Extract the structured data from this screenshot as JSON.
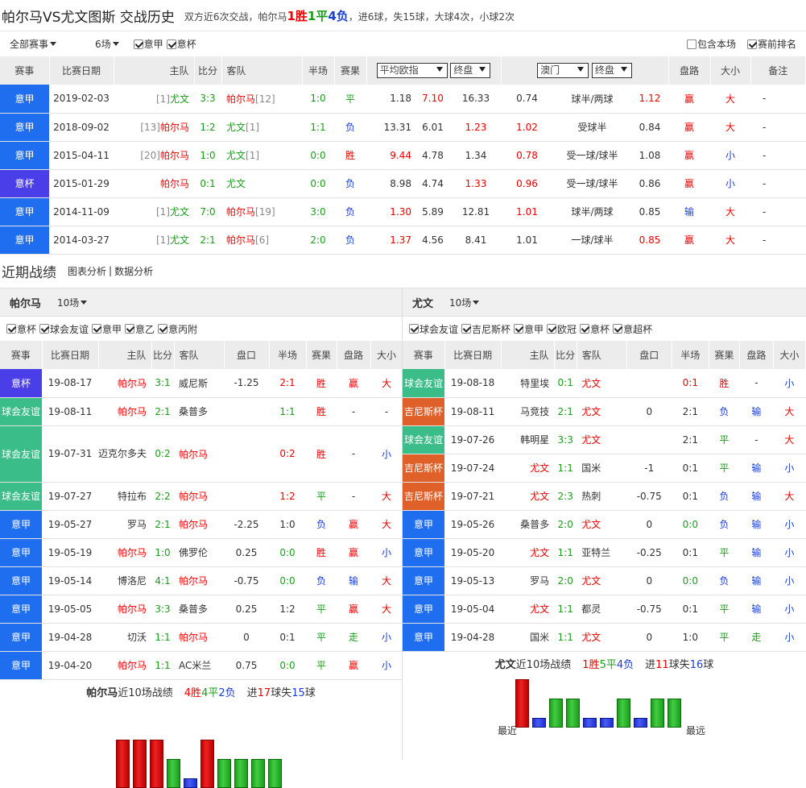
{
  "header": {
    "title": "帕尔马VS尤文图斯 交战历史",
    "summary_pre": "双方近6次交战，帕尔马",
    "win": "1胜",
    "draw": "1平",
    "loss": "4负",
    "summary_post": "，进6球，失15球，大球4次，小球2次"
  },
  "filter": {
    "all": "全部赛事",
    "count": "6场",
    "cb1": "意甲",
    "cb2": "意杯",
    "include": "包含本场",
    "rank": "赛前排名"
  },
  "h2h_cols": [
    "赛事",
    "比赛日期",
    "主队",
    "比分",
    "客队",
    "半场",
    "赛果",
    "平均欧指",
    "终盘",
    "澳门",
    "终盘",
    "盘路",
    "大小",
    "备注"
  ],
  "h2h_rows": [
    {
      "lg": "意甲",
      "lc": "#1f6ef0",
      "date": "2019-02-03",
      "hr": "[1]",
      "home": "尤文",
      "hc": "g",
      "score": "3:3",
      "away": "帕尔马",
      "ac": "r",
      "ar": "[12]",
      "ht": "1:0",
      "res": "平",
      "rc": "g",
      "o1": "1.18",
      "o2": "7.10",
      "o3": "16.33",
      "o2c": "r",
      "o3c": "",
      "a1": "0.74",
      "hcp": "球半/两球",
      "a2": "1.12",
      "a1c": "",
      "a2c": "r",
      "pl": "赢",
      "plc": "r",
      "ou": "大",
      "ouc": "r",
      "note": "-"
    },
    {
      "lg": "意甲",
      "lc": "#1f6ef0",
      "date": "2018-09-02",
      "hr": "[13]",
      "home": "帕尔马",
      "hc": "r",
      "score": "1:2",
      "away": "尤文",
      "ac": "g",
      "ar": "[1]",
      "ht": "1:1",
      "res": "负",
      "rc": "b",
      "o1": "13.31",
      "o2": "6.01",
      "o3": "1.23",
      "o2c": "",
      "o3c": "r",
      "a1": "1.02",
      "hcp": "受球半",
      "a2": "0.84",
      "a1c": "r",
      "a2c": "",
      "pl": "赢",
      "plc": "r",
      "ou": "大",
      "ouc": "r",
      "note": "-"
    },
    {
      "lg": "意甲",
      "lc": "#1f6ef0",
      "date": "2015-04-11",
      "hr": "[20]",
      "home": "帕尔马",
      "hc": "r",
      "score": "1:0",
      "away": "尤文",
      "ac": "g",
      "ar": "[1]",
      "ht": "0:0",
      "res": "胜",
      "rc": "r",
      "o1": "9.44",
      "o2": "4.78",
      "o3": "1.34",
      "o2c": "",
      "o3c": "",
      "a1": "0.78",
      "hcp": "受一球/球半",
      "a2": "1.08",
      "a1c": "r",
      "a2c": "",
      "pl": "赢",
      "plc": "r",
      "ou": "小",
      "ouc": "b",
      "note": "-",
      "o1c": "r"
    },
    {
      "lg": "意杯",
      "lc": "#4a3ee8",
      "date": "2015-01-29",
      "hr": "",
      "home": "帕尔马",
      "hc": "r",
      "score": "0:1",
      "away": "尤文",
      "ac": "g",
      "ar": "",
      "ht": "0:0",
      "res": "负",
      "rc": "b",
      "o1": "8.98",
      "o2": "4.74",
      "o3": "1.33",
      "o2c": "",
      "o3c": "r",
      "a1": "0.96",
      "hcp": "受一球/球半",
      "a2": "0.86",
      "a1c": "r",
      "a2c": "",
      "pl": "赢",
      "plc": "r",
      "ou": "小",
      "ouc": "b",
      "note": "-"
    },
    {
      "lg": "意甲",
      "lc": "#1f6ef0",
      "date": "2014-11-09",
      "hr": "[1]",
      "home": "尤文",
      "hc": "g",
      "score": "7:0",
      "away": "帕尔马",
      "ac": "r",
      "ar": "[19]",
      "ht": "3:0",
      "res": "负",
      "rc": "b",
      "o1": "1.30",
      "o2": "5.89",
      "o3": "12.81",
      "o2c": "",
      "o3c": "",
      "a1": "1.01",
      "hcp": "球半/两球",
      "a2": "0.85",
      "a1c": "r",
      "a2c": "",
      "pl": "输",
      "plc": "b",
      "ou": "大",
      "ouc": "r",
      "note": "-",
      "o1c": "r"
    },
    {
      "lg": "意甲",
      "lc": "#1f6ef0",
      "date": "2014-03-27",
      "hr": "[1]",
      "home": "尤文",
      "hc": "g",
      "score": "2:1",
      "away": "帕尔马",
      "ac": "r",
      "ar": "[6]",
      "ht": "2:0",
      "res": "负",
      "rc": "b",
      "o1": "1.37",
      "o2": "4.56",
      "o3": "8.41",
      "o2c": "",
      "o3c": "",
      "a1": "1.01",
      "hcp": "一球/球半",
      "a2": "0.85",
      "a1c": "",
      "a2c": "r",
      "pl": "赢",
      "plc": "r",
      "ou": "大",
      "ouc": "r",
      "note": "-",
      "o1c": "r"
    }
  ],
  "h2h_dd": {
    "avg": "平均欧指",
    "end1": "终盘",
    "macau": "澳门",
    "end2": "终盘"
  },
  "recent": {
    "title": "近期战绩",
    "chart_link": "图表分析",
    "data_link": "数据分析",
    "sep": "|"
  },
  "left": {
    "team": "帕尔马",
    "count": "10场",
    "filters": [
      "意杯",
      "球会友谊",
      "意甲",
      "意乙",
      "意丙附"
    ],
    "cols": [
      "赛事",
      "比赛日期",
      "主队",
      "比分",
      "客队",
      "盘口",
      "半场",
      "赛果",
      "盘路",
      "大小"
    ],
    "rows": [
      {
        "lg": "意杯",
        "lc": "#4a3ee8",
        "date": "19-08-17",
        "home": "帕尔马",
        "hc": "r",
        "score": "3:1",
        "away": "威尼斯",
        "ac": "",
        "hcp": "-1.25",
        "ht": "2:1",
        "htc": "r",
        "res": "胜",
        "rc": "r",
        "pl": "赢",
        "plc": "r",
        "ou": "大",
        "ouc": "r"
      },
      {
        "lg": "球会友谊",
        "lc": "#3bbd8a",
        "date": "19-08-11",
        "home": "帕尔马",
        "hc": "r",
        "score": "2:1",
        "away": "桑普多",
        "ac": "",
        "hcp": "",
        "ht": "1:1",
        "htc": "g",
        "res": "胜",
        "rc": "r",
        "pl": "-",
        "plc": "",
        "ou": "-",
        "ouc": ""
      },
      {
        "lg": "球会友谊",
        "lc": "#3bbd8a",
        "date": "19-07-31",
        "home": "迈克尔多夫",
        "hc": "",
        "score": "0:2",
        "away": "帕尔马",
        "ac": "r",
        "hcp": "",
        "ht": "0:2",
        "htc": "r",
        "res": "胜",
        "rc": "r",
        "pl": "-",
        "plc": "",
        "ou": "小",
        "ouc": "b",
        "tall": true
      },
      {
        "lg": "球会友谊",
        "lc": "#3bbd8a",
        "date": "19-07-27",
        "home": "特拉布",
        "hc": "",
        "score": "2:2",
        "away": "帕尔马",
        "ac": "r",
        "hcp": "",
        "ht": "1:2",
        "htc": "r",
        "res": "平",
        "rc": "g",
        "pl": "-",
        "plc": "",
        "ou": "大",
        "ouc": "r"
      },
      {
        "lg": "意甲",
        "lc": "#1f6ef0",
        "date": "19-05-27",
        "home": "罗马",
        "hc": "",
        "score": "2:1",
        "away": "帕尔马",
        "ac": "r",
        "hcp": "-2.25",
        "ht": "1:0",
        "htc": "",
        "res": "负",
        "rc": "b",
        "pl": "赢",
        "plc": "r",
        "ou": "大",
        "ouc": "r"
      },
      {
        "lg": "意甲",
        "lc": "#1f6ef0",
        "date": "19-05-19",
        "home": "帕尔马",
        "hc": "r",
        "score": "1:0",
        "away": "佛罗伦",
        "ac": "",
        "hcp": "0.25",
        "ht": "0:0",
        "htc": "g",
        "res": "胜",
        "rc": "r",
        "pl": "赢",
        "plc": "r",
        "ou": "小",
        "ouc": "b"
      },
      {
        "lg": "意甲",
        "lc": "#1f6ef0",
        "date": "19-05-14",
        "home": "博洛尼",
        "hc": "",
        "score": "4:1",
        "away": "帕尔马",
        "ac": "r",
        "hcp": "-0.75",
        "ht": "0:0",
        "htc": "g",
        "res": "负",
        "rc": "b",
        "pl": "输",
        "plc": "b",
        "ou": "大",
        "ouc": "r"
      },
      {
        "lg": "意甲",
        "lc": "#1f6ef0",
        "date": "19-05-05",
        "home": "帕尔马",
        "hc": "r",
        "score": "3:3",
        "away": "桑普多",
        "ac": "",
        "hcp": "0.25",
        "ht": "1:2",
        "htc": "",
        "res": "平",
        "rc": "g",
        "pl": "赢",
        "plc": "r",
        "ou": "大",
        "ouc": "r"
      },
      {
        "lg": "意甲",
        "lc": "#1f6ef0",
        "date": "19-04-28",
        "home": "切沃",
        "hc": "",
        "score": "1:1",
        "away": "帕尔马",
        "ac": "r",
        "hcp": "0",
        "ht": "0:1",
        "htc": "",
        "res": "平",
        "rc": "g",
        "pl": "走",
        "plc": "g",
        "ou": "小",
        "ouc": "b"
      },
      {
        "lg": "意甲",
        "lc": "#1f6ef0",
        "date": "19-04-20",
        "home": "帕尔马",
        "hc": "r",
        "score": "1:1",
        "away": "AC米兰",
        "ac": "",
        "hcp": "0.75",
        "ht": "0:0",
        "htc": "g",
        "res": "平",
        "rc": "g",
        "pl": "赢",
        "plc": "r",
        "ou": "小",
        "ouc": "b"
      }
    ],
    "summary": {
      "team": "帕尔马",
      "mid": "近10场战绩",
      "w": "4胜",
      "d": "4平",
      "l": "2负",
      "goals_pre": "进",
      "gf": "17",
      "goals_mid": "球失",
      "ga": "15",
      "goals_post": "球"
    },
    "bars": [
      "w",
      "w",
      "w",
      "d",
      "l",
      "w",
      "d",
      "d",
      "d",
      "d"
    ],
    "bar_levels": [
      5,
      5,
      5,
      3,
      1,
      5,
      3,
      3,
      3,
      3
    ]
  },
  "right": {
    "team": "尤文",
    "count": "10场",
    "filters": [
      "球会友谊",
      "吉尼斯杯",
      "意甲",
      "欧冠",
      "意杯",
      "意超杯"
    ],
    "cols": [
      "赛事",
      "比赛日期",
      "主队",
      "比分",
      "客队",
      "盘口",
      "半场",
      "赛果",
      "盘路",
      "大小"
    ],
    "rows": [
      {
        "lg": "球会友谊",
        "lc": "#3bbd8a",
        "date": "19-08-18",
        "home": "特里埃",
        "hc": "",
        "score": "0:1",
        "away": "尤文",
        "ac": "r",
        "hcp": "",
        "ht": "0:1",
        "htc": "r",
        "res": "胜",
        "rc": "r",
        "pl": "-",
        "plc": "",
        "ou": "小",
        "ouc": "b"
      },
      {
        "lg": "吉尼斯杯",
        "lc": "#e0602a",
        "date": "19-08-11",
        "home": "马竞技",
        "hc": "",
        "score": "2:1",
        "away": "尤文",
        "ac": "r",
        "hcp": "0",
        "ht": "2:1",
        "htc": "",
        "res": "负",
        "rc": "b",
        "pl": "输",
        "plc": "b",
        "ou": "大",
        "ouc": "r"
      },
      {
        "lg": "球会友谊",
        "lc": "#3bbd8a",
        "date": "19-07-26",
        "home": "韩明星",
        "hc": "",
        "score": "3:3",
        "away": "尤文",
        "ac": "r",
        "hcp": "",
        "ht": "2:1",
        "htc": "",
        "res": "平",
        "rc": "g",
        "pl": "-",
        "plc": "",
        "ou": "大",
        "ouc": "r"
      },
      {
        "lg": "吉尼斯杯",
        "lc": "#e0602a",
        "date": "19-07-24",
        "home": "尤文",
        "hc": "r",
        "score": "1:1",
        "away": "国米",
        "ac": "",
        "hcp": "-1",
        "ht": "0:1",
        "htc": "",
        "res": "平",
        "rc": "g",
        "pl": "输",
        "plc": "b",
        "ou": "小",
        "ouc": "b"
      },
      {
        "lg": "吉尼斯杯",
        "lc": "#e0602a",
        "date": "19-07-21",
        "home": "尤文",
        "hc": "r",
        "score": "2:3",
        "away": "热刺",
        "ac": "",
        "hcp": "-0.75",
        "ht": "0:1",
        "htc": "",
        "res": "负",
        "rc": "b",
        "pl": "输",
        "plc": "b",
        "ou": "大",
        "ouc": "r"
      },
      {
        "lg": "意甲",
        "lc": "#1f6ef0",
        "date": "19-05-26",
        "home": "桑普多",
        "hc": "",
        "score": "2:0",
        "away": "尤文",
        "ac": "r",
        "hcp": "0",
        "ht": "0:0",
        "htc": "g",
        "res": "负",
        "rc": "b",
        "pl": "输",
        "plc": "b",
        "ou": "小",
        "ouc": "b"
      },
      {
        "lg": "意甲",
        "lc": "#1f6ef0",
        "date": "19-05-20",
        "home": "尤文",
        "hc": "r",
        "score": "1:1",
        "away": "亚特兰",
        "ac": "",
        "hcp": "-0.25",
        "ht": "0:1",
        "htc": "",
        "res": "平",
        "rc": "g",
        "pl": "输",
        "plc": "b",
        "ou": "小",
        "ouc": "b"
      },
      {
        "lg": "意甲",
        "lc": "#1f6ef0",
        "date": "19-05-13",
        "home": "罗马",
        "hc": "",
        "score": "2:0",
        "away": "尤文",
        "ac": "r",
        "hcp": "0",
        "ht": "0:0",
        "htc": "g",
        "res": "负",
        "rc": "b",
        "pl": "输",
        "plc": "b",
        "ou": "小",
        "ouc": "b"
      },
      {
        "lg": "意甲",
        "lc": "#1f6ef0",
        "date": "19-05-04",
        "home": "尤文",
        "hc": "r",
        "score": "1:1",
        "away": "都灵",
        "ac": "",
        "hcp": "-0.75",
        "ht": "0:1",
        "htc": "",
        "res": "平",
        "rc": "g",
        "pl": "输",
        "plc": "b",
        "ou": "小",
        "ouc": "b"
      },
      {
        "lg": "意甲",
        "lc": "#1f6ef0",
        "date": "19-04-28",
        "home": "国米",
        "hc": "",
        "score": "1:1",
        "away": "尤文",
        "ac": "r",
        "hcp": "0",
        "ht": "1:0",
        "htc": "",
        "res": "平",
        "rc": "g",
        "pl": "走",
        "plc": "g",
        "ou": "小",
        "ouc": "b"
      }
    ],
    "summary": {
      "team": "尤文",
      "mid": "近10场战绩",
      "w": "1胜",
      "d": "5平",
      "l": "4负",
      "goals_pre": "进",
      "gf": "11",
      "goals_mid": "球失",
      "ga": "16",
      "goals_post": "球"
    },
    "bars": [
      "w",
      "l",
      "d",
      "d",
      "l",
      "l",
      "d",
      "l",
      "d",
      "d"
    ],
    "bar_levels": [
      5,
      1,
      3,
      3,
      1,
      1,
      3,
      1,
      3,
      3
    ],
    "near": "最近",
    "far": "最远"
  }
}
